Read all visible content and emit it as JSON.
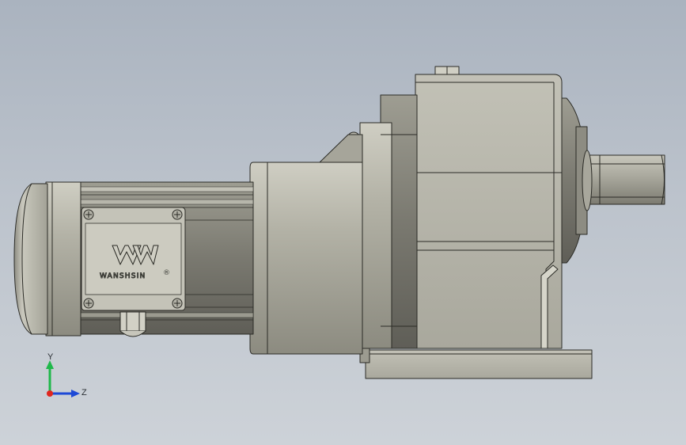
{
  "scene": {
    "view": "side",
    "background_colors": [
      "#aab3bf",
      "#cdd2d8"
    ],
    "part_color": "#b6b5a9",
    "edge_color": "#2b2b26"
  },
  "model": {
    "brand_label": "WANSHSIN",
    "registered_mark": "®",
    "logo": "wanshsin-logo"
  },
  "triad": {
    "y_label": "Y",
    "z_label": "Z",
    "x_color": "#e0261f",
    "y_color": "#1fb84a",
    "z_color": "#1d49d6"
  }
}
